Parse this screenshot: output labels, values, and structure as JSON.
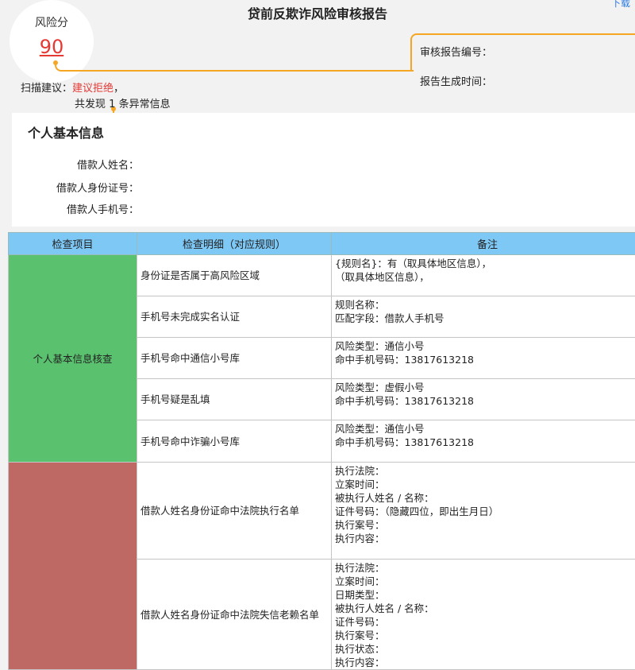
{
  "header": {
    "title": "贷前反欺诈风险审核报告",
    "download_label": "下载"
  },
  "score": {
    "label": "风险分",
    "value": "90"
  },
  "report": {
    "number_label": "审核报告编号：",
    "time_label": "报告生成时间："
  },
  "scan": {
    "prefix": "扫描建议：",
    "suggestion": "建议拒绝",
    "suffix": "，",
    "found_prefix": "共发现",
    "found_count": "1",
    "found_suffix": "条异常信息"
  },
  "personal_info": {
    "title": "个人基本信息",
    "name_label": "借款人姓名：",
    "id_label": "借款人身份证号：",
    "phone_label": "借款人手机号："
  },
  "table": {
    "headers": [
      "检查项目",
      "检查明细（对应规则）",
      "备注"
    ],
    "groups": [
      {
        "category": "个人基本信息核查",
        "color": "#5ac26e",
        "rows": [
          {
            "detail": "身份证是否属于高风险区域",
            "notes": [
              "{规则名}：有（取具体地区信息），",
              "（取具体地区信息），"
            ]
          },
          {
            "detail": "手机号未完成实名认证",
            "notes": [
              "规则名称：",
              "匹配字段：借款人手机号"
            ]
          },
          {
            "detail": "手机号命中通信小号库",
            "notes": [
              "风险类型：通信小号",
              "命中手机号码：13817613218"
            ]
          },
          {
            "detail": "手机号疑是乱填",
            "notes": [
              "风险类型：虚假小号",
              "命中手机号码：13817613218"
            ]
          },
          {
            "detail": "手机号命中诈骗小号库",
            "notes": [
              "风险类型：通信小号",
              "命中手机号码：13817613218"
            ]
          }
        ]
      },
      {
        "category": "",
        "color": "#bf6964",
        "rows": [
          {
            "detail": "借款人姓名身份证命中法院执行名单",
            "notes": [
              "执行法院：",
              "立案时间：",
              "被执行人姓名 / 名称：",
              "证件号码：（隐藏四位，即出生月日）",
              "执行案号：",
              "执行内容："
            ]
          },
          {
            "detail": "借款人姓名身份证命中法院失信老赖名单",
            "notes": [
              "执行法院：",
              "立案时间：",
              "日期类型：",
              "被执行人姓名 / 名称：",
              "证件号码：",
              "执行案号：",
              "执行状态：",
              "执行内容："
            ]
          }
        ]
      }
    ]
  }
}
